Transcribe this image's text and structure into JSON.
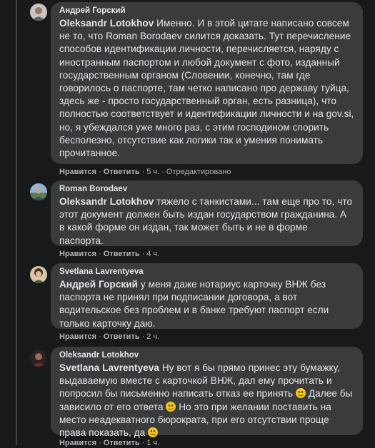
{
  "comments": [
    {
      "author": "Андрей Горский",
      "mention": "Oleksandr Lotokhov",
      "text": " Именно. И в этой цитате написано совсем не то, что Roman Borodaev силится доказать. Тут перечисление способов идентификации личности, перечисляется, наряду с иностранным паспортом и любой документ с фото, изданный государственным органом (Словении, конечно, там где говорилось о паспорте, там четко написано про державу туйца, здесь же - просто государственный орган, есть разница), что полностью соответствует и идентификации личности и на gov.si, но, я убеждался уже много раз, с этим господином спорить бесполезно, отсутствие как логики так и умения понимать прочитанное.",
      "like": "Нравится",
      "reply": "Ответить",
      "time": "5 ч.",
      "edited": "Отредактировано"
    },
    {
      "author": "Roman Borodaev",
      "mention": "Oleksandr Lotokhov",
      "text": " тяжело с танкистами... там еще про то, что этот документ должен быть издан государством гражданина. А в какой форме он издан, так может быть и не в форме паспорта.",
      "like": "Нравится",
      "reply": "Ответить",
      "time": "4 ч."
    },
    {
      "author": "Svetlana Lavrentyeva",
      "mention": "Андрей Горский",
      "text": " у меня даже нотариус карточку ВНЖ без паспорта не принял при подписании договора, а вот водительское без проблем и в банке требуют паспорт если только карточку даю.",
      "like": "Нравится",
      "reply": "Ответить",
      "time": "2 ч."
    },
    {
      "author": "Oleksandr Lotokhov",
      "mention": "Svetlana Lavrentyeva",
      "text_a": " Ну вот я бы прямо принес эту бумажку, выдаваемую вместе с карточкой ВНЖ, дал ему прочитать и попросил бы письменно написать отказ ее принять ",
      "text_b": " Далее бы зависило от его ответа ",
      "text_c": " Но это при желании поставить на место неадекватного бюрократа, при его отсутствии проще права показать, да ",
      "like": "Нравится",
      "reply": "Ответить",
      "time": "1 ч."
    }
  ],
  "separator": "·",
  "icons": {
    "emoji": "smiley-emoji-icon"
  }
}
